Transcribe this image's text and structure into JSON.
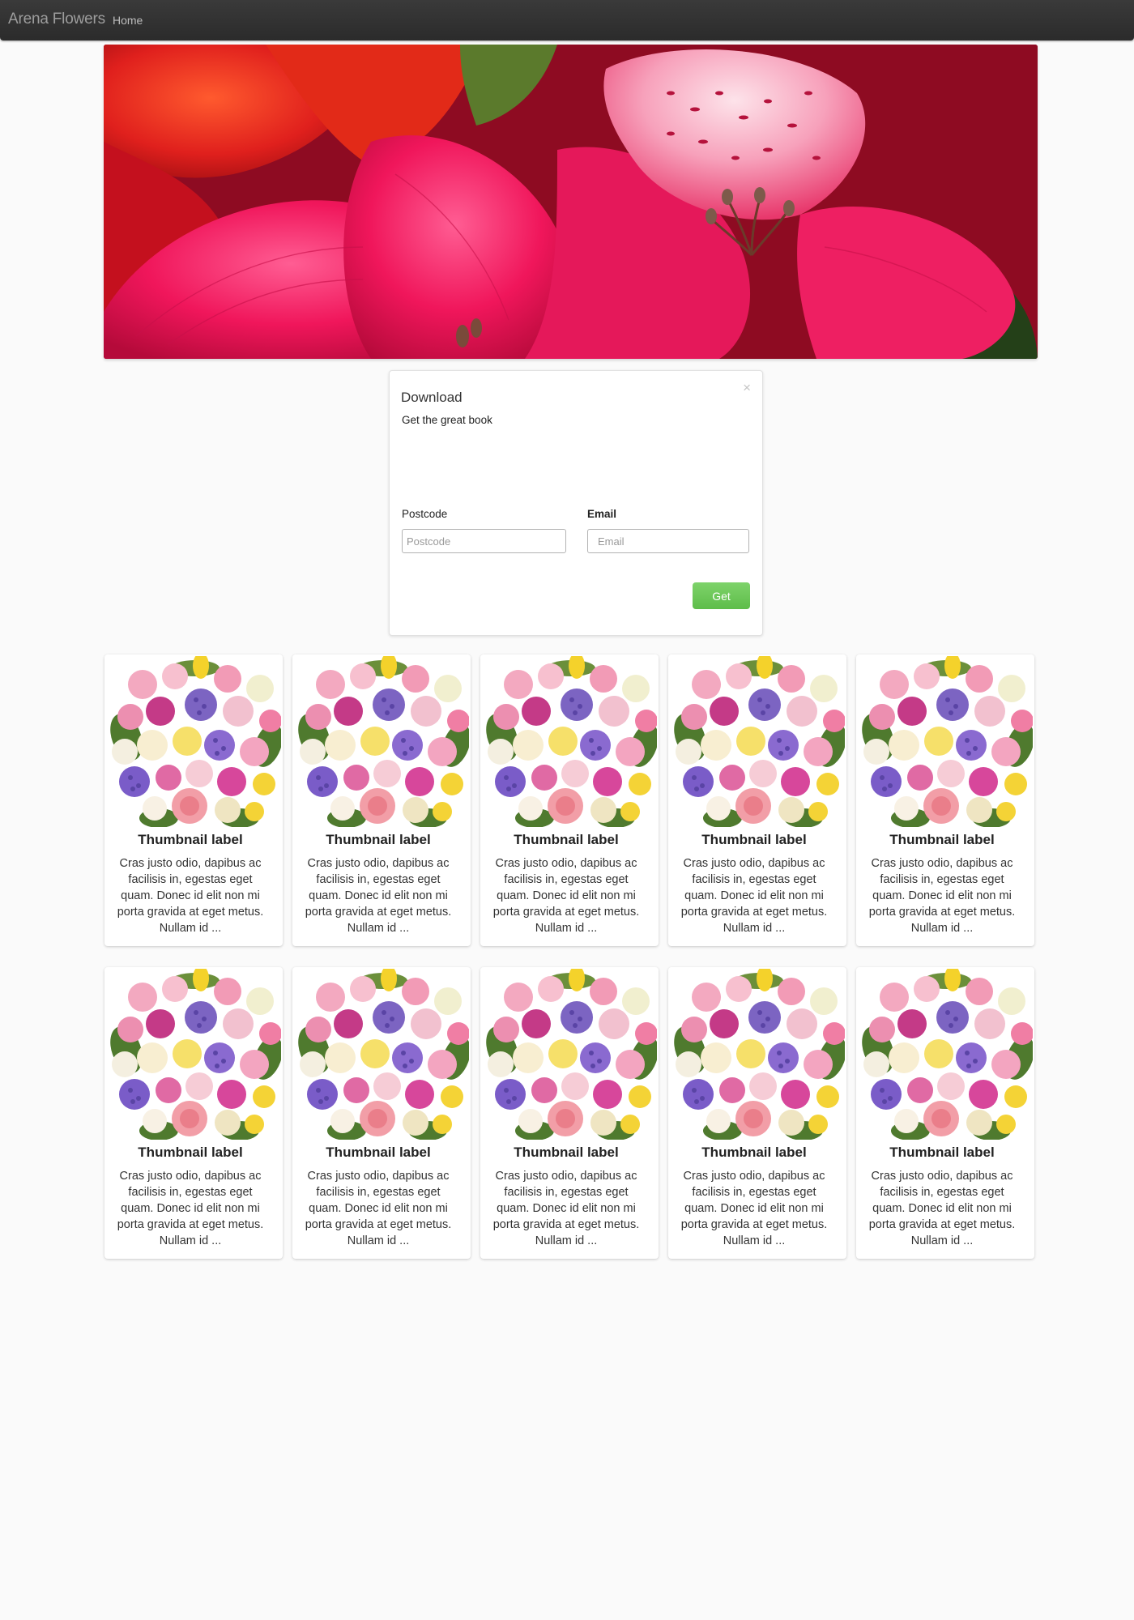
{
  "navbar": {
    "brand": "Arena Flowers",
    "links": [
      {
        "label": "Home"
      }
    ]
  },
  "hero": {
    "image": "flower-photo"
  },
  "download_panel": {
    "close_icon": "×",
    "title": "Download",
    "subtitle": "Get the great book",
    "fields": [
      {
        "label": "Postcode",
        "placeholder": "Postcode",
        "value": ""
      },
      {
        "label": "Email",
        "placeholder": "Email",
        "value": ""
      }
    ],
    "submit_label": "Get",
    "submit_color": "#62c250"
  },
  "thumbnails": [
    {
      "label": "Thumbnail label",
      "text": "Cras justo odio, dapibus ac facilisis in, egestas eget quam. Donec id elit non mi porta gravida at eget metus. Nullam id ..."
    },
    {
      "label": "Thumbnail label",
      "text": "Cras justo odio, dapibus ac facilisis in, egestas eget quam. Donec id elit non mi porta gravida at eget metus. Nullam id ..."
    },
    {
      "label": "Thumbnail label",
      "text": "Cras justo odio, dapibus ac facilisis in, egestas eget quam. Donec id elit non mi porta gravida at eget metus. Nullam id ..."
    },
    {
      "label": "Thumbnail label",
      "text": "Cras justo odio, dapibus ac facilisis in, egestas eget quam. Donec id elit non mi porta gravida at eget metus. Nullam id ..."
    },
    {
      "label": "Thumbnail label",
      "text": "Cras justo odio, dapibus ac facilisis in, egestas eget quam. Donec id elit non mi porta gravida at eget metus. Nullam id ..."
    },
    {
      "label": "Thumbnail label",
      "text": "Cras justo odio, dapibus ac facilisis in, egestas eget quam. Donec id elit non mi porta gravida at eget metus. Nullam id ..."
    },
    {
      "label": "Thumbnail label",
      "text": "Cras justo odio, dapibus ac facilisis in, egestas eget quam. Donec id elit non mi porta gravida at eget metus. Nullam id ..."
    },
    {
      "label": "Thumbnail label",
      "text": "Cras justo odio, dapibus ac facilisis in, egestas eget quam. Donec id elit non mi porta gravida at eget metus. Nullam id ..."
    },
    {
      "label": "Thumbnail label",
      "text": "Cras justo odio, dapibus ac facilisis in, egestas eget quam. Donec id elit non mi porta gravida at eget metus. Nullam id ..."
    },
    {
      "label": "Thumbnail label",
      "text": "Cras justo odio, dapibus ac facilisis in, egestas eget quam. Donec id elit non mi porta gravida at eget metus. Nullam id ..."
    }
  ]
}
